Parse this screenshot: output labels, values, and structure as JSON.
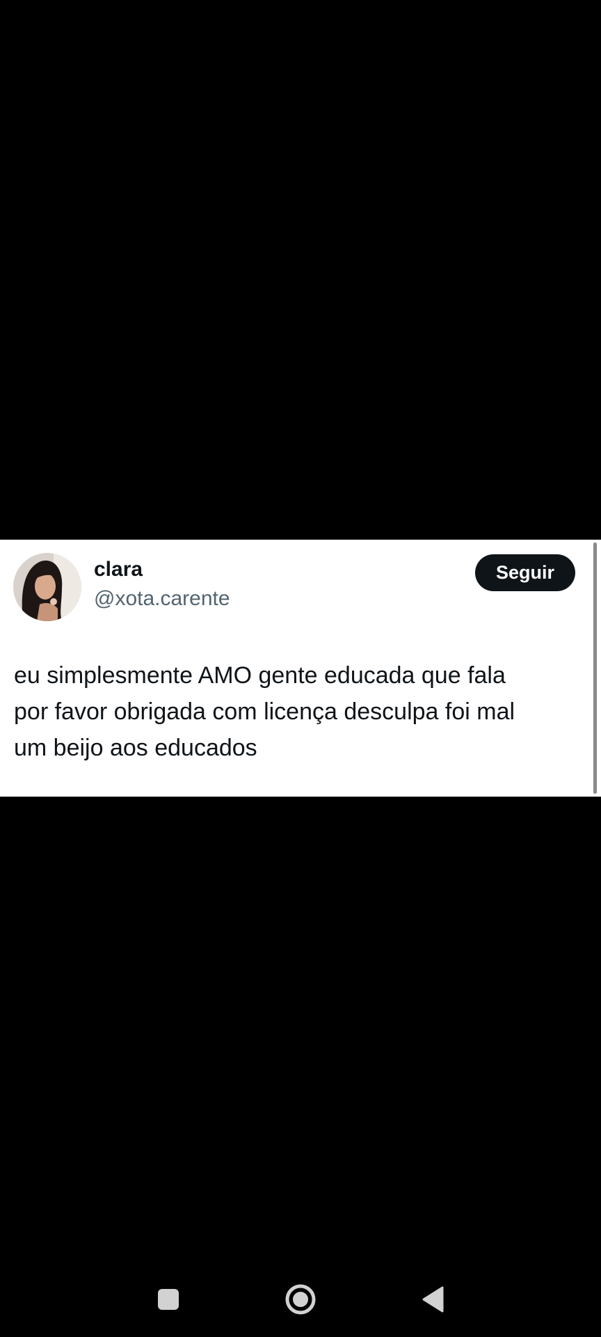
{
  "tweet": {
    "author": {
      "display_name": "clara",
      "handle": "@xota.carente"
    },
    "follow_button_label": "Seguir",
    "text_lines": [
      "eu simplesmente AMO gente educada que fala",
      "por favor obrigada com licença desculpa foi mal",
      "um beijo aos educados"
    ]
  },
  "navigation_bar": {
    "icons": [
      "recent-apps-icon",
      "home-icon",
      "back-icon"
    ]
  },
  "colors": {
    "background": "#000000",
    "card": "#ffffff",
    "text_primary": "#0f1419",
    "text_secondary": "#536471",
    "button": "#0f1419"
  }
}
